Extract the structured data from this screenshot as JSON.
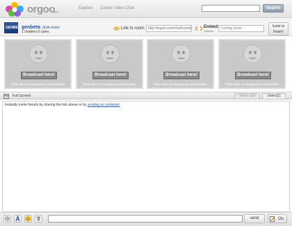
{
  "header": {
    "brand": "orgoo",
    "brand_sub": "beta",
    "nav": [
      "Explore",
      "Create Video Chat"
    ],
    "search_value": "",
    "search_button": "Search"
  },
  "room": {
    "name": "genbeta",
    "subname": "(Edit room)",
    "stats": "1 chatters 0 cams",
    "avatar_text": "GENBETA",
    "link_label": "Link to room:",
    "link_value": "http://orgoo.com/chat/room/genbeta",
    "embed_label": "Embed:",
    "embed_options": "Options",
    "embed_value": "Coming Soon...",
    "invite_button": [
      "Invite to",
      "Room!"
    ]
  },
  "video_tiles": [
    {
      "button": "Broadcast here!",
      "caption": "Click here to broadcast voice/video"
    },
    {
      "button": "Broadcast here!",
      "caption": "Click here to broadcast voice/video"
    },
    {
      "button": "Broadcast here!",
      "caption": "Click here to broadcast voice/video"
    },
    {
      "button": "Broadcast here!",
      "caption": "Click here to broadcast voice/video"
    }
  ],
  "chat_toolbar": {
    "fullscreen": "Full Screen!",
    "video_call": "Video Call",
    "users": "Users(1)"
  },
  "chat": {
    "message_prefix": "Instantly invite friends by sharing the link above or by",
    "message_link": "sending an invitation!"
  },
  "composer": {
    "input_value": "",
    "send_button": "send",
    "on_button": "On"
  },
  "icons": {
    "logo": "flower-logo-icon",
    "link": "link-icon",
    "embed": "embed-icon",
    "fullscreen": "fullscreen-icon",
    "tools": [
      "settings-icon",
      "font-icon",
      "emoticon-icon",
      "trash-icon"
    ],
    "on": "edit-toggle-icon"
  },
  "colors": {
    "accent_blue": "#2458a8",
    "tile_gray": "#c9c9c9",
    "search_button": "#8e9cab"
  }
}
